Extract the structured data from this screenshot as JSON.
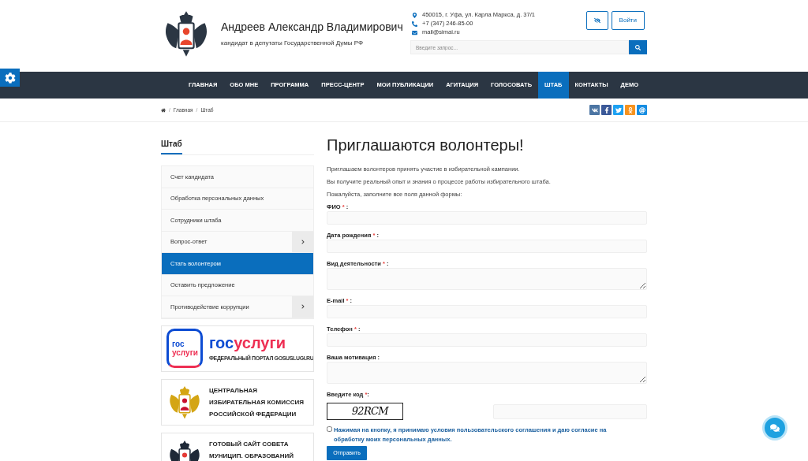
{
  "header": {
    "name": "Андреев Александр Владимирович",
    "subtitle": "кандидат в депутаты Государственной Думы РФ",
    "contacts": [
      {
        "kind": "pin",
        "text": "450015, г. Уфа, ул. Карла Маркса, д. 37/1"
      },
      {
        "kind": "phone",
        "text": "+7 (347) 246-85-00"
      },
      {
        "kind": "mail",
        "text": "mail@simai.ru"
      }
    ],
    "login": "Войти",
    "search": {
      "placeholder": "Введите запрос..."
    }
  },
  "nav": [
    {
      "label": "ГЛАВНАЯ",
      "selected": false
    },
    {
      "label": "ОБО МНЕ",
      "selected": false
    },
    {
      "label": "ПРОГРАММА",
      "selected": false
    },
    {
      "label": "ПРЕСС-ЦЕНТР",
      "selected": false
    },
    {
      "label": "МОИ ПУБЛИКАЦИИ",
      "selected": false
    },
    {
      "label": "АГИТАЦИЯ",
      "selected": false
    },
    {
      "label": "ГОЛОСОВАТЬ",
      "selected": false
    },
    {
      "label": "ШТАБ",
      "selected": true
    },
    {
      "label": "КОНТАКТЫ",
      "selected": false
    },
    {
      "label": "ДЕМО",
      "selected": false
    }
  ],
  "breadcrumb": {
    "separator": "/",
    "items": [
      "Главная",
      "Штаб"
    ]
  },
  "share": [
    {
      "kind": "vk",
      "color": "#4c75a3"
    },
    {
      "kind": "facebook",
      "color": "#3b5998"
    },
    {
      "kind": "twitter",
      "color": "#1da1f2"
    },
    {
      "kind": "ok",
      "color": "#f7931e"
    },
    {
      "kind": "mailru",
      "color": "#168de2"
    }
  ],
  "sidebar": {
    "title": "Штаб",
    "items": [
      {
        "label": "Счет кандидата",
        "selected": false,
        "submenu": false
      },
      {
        "label": "Обработка персональных данных",
        "selected": false,
        "submenu": false
      },
      {
        "label": "Сотрудники штаба",
        "selected": false,
        "submenu": false
      },
      {
        "label": "Вопрос-ответ",
        "selected": false,
        "submenu": true
      },
      {
        "label": "Стать волонтером",
        "selected": true,
        "submenu": false
      },
      {
        "label": "Оставить предложение",
        "selected": false,
        "submenu": false
      },
      {
        "label": "Противодействие коррупции",
        "selected": false,
        "submenu": true
      }
    ],
    "banners": [
      {
        "kind": "gosuslugi",
        "logo_text": [
          "гос",
          "услуги"
        ],
        "brand": [
          {
            "text": "гос",
            "color": "#0d4cd3"
          },
          {
            "text": "услуги",
            "color": "#ee2f53"
          }
        ],
        "lines": [
          "ФЕДЕРАЛЬНЫЙ ПОРТАЛ GOSUSLUGI.RU"
        ]
      },
      {
        "kind": "cik",
        "lines": [
          "ЦЕНТРАЛЬНАЯ",
          "ИЗБИРАТЕЛЬНАЯ КОМИССИЯ",
          "РОССИЙСКОЙ ФЕДЕРАЦИИ"
        ]
      },
      {
        "kind": "council",
        "lines": [
          "ГОТОВЫЙ САЙТ СОВЕТА",
          "МУНИЦИП. ОБРАЗОВАНИЙ"
        ]
      }
    ]
  },
  "content": {
    "title": "Приглашаются волонтеры!",
    "paragraphs": [
      "Приглашаем волонтеров принять участие в избирательной кампании.",
      "Вы получите реальный опыт и знания о процессе работы избирательного штаба.",
      "Пожалуйста, заполните все поля данной формы:"
    ],
    "fields": [
      {
        "kind": "input",
        "label": "ФИО",
        "mark": "*",
        "suffix": " :"
      },
      {
        "kind": "input",
        "label": "Дата рождения",
        "mark": "*",
        "suffix": " :"
      },
      {
        "kind": "textarea",
        "label": "Вид деятельности",
        "mark": "*",
        "suffix": " :"
      },
      {
        "kind": "input",
        "label": "E-mail",
        "mark": "*",
        "suffix": " :"
      },
      {
        "kind": "input",
        "label": "Телефон",
        "mark": "*",
        "suffix": " :"
      },
      {
        "kind": "textarea",
        "label": "Ваша мотивация",
        "suffix": " :"
      }
    ],
    "captcha": {
      "label": "Введите код",
      "mark": "*",
      "suffix": ":",
      "code": "92RCM"
    },
    "consent": {
      "checked": false,
      "text": "Нажимая на кнопку, я принимаю условия пользовательского соглашения и даю согласие на обработку моих персональных данных."
    },
    "submit": "Отправить"
  }
}
